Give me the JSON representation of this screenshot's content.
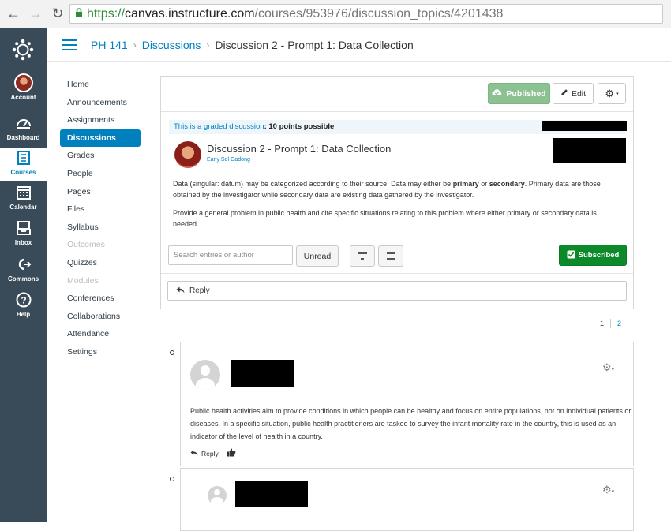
{
  "browser": {
    "url_scheme": "https://",
    "url_host": "canvas.instructure.com",
    "url_path": "/courses/953976/discussion_topics/4201438"
  },
  "global_nav": {
    "items": [
      {
        "label": "Account",
        "icon": "avatar"
      },
      {
        "label": "Dashboard",
        "icon": "dashboard-icon"
      },
      {
        "label": "Courses",
        "icon": "courses-icon",
        "active": true
      },
      {
        "label": "Calendar",
        "icon": "calendar-icon"
      },
      {
        "label": "Inbox",
        "icon": "inbox-icon"
      },
      {
        "label": "Commons",
        "icon": "commons-icon"
      },
      {
        "label": "Help",
        "icon": "help-icon"
      }
    ]
  },
  "breadcrumb": {
    "course": "PH 141",
    "section": "Discussions",
    "current": "Discussion 2 - Prompt 1: Data Collection"
  },
  "course_nav": {
    "items": [
      {
        "label": "Home"
      },
      {
        "label": "Announcements"
      },
      {
        "label": "Assignments"
      },
      {
        "label": "Discussions",
        "active": true
      },
      {
        "label": "Grades"
      },
      {
        "label": "People"
      },
      {
        "label": "Pages"
      },
      {
        "label": "Files"
      },
      {
        "label": "Syllabus"
      },
      {
        "label": "Outcomes",
        "disabled": true
      },
      {
        "label": "Quizzes"
      },
      {
        "label": "Modules",
        "disabled": true
      },
      {
        "label": "Conferences"
      },
      {
        "label": "Collaborations"
      },
      {
        "label": "Attendance"
      },
      {
        "label": "Settings"
      }
    ]
  },
  "topic": {
    "published_label": "Published",
    "edit_label": "Edit",
    "graded_prefix": "This is a graded discussion",
    "graded_points": ": 10 points possible",
    "title": "Discussion 2 - Prompt 1: Data Collection",
    "author": "Early Sol Gadong",
    "para1_a": "Data (singular: datum) may be categorized according to their source. Data may either be ",
    "para1_b": "primary",
    "para1_c": " or ",
    "para1_d": "secondary",
    "para1_e": ". Primary data are those obtained by the investigator while secondary data are existing data gathered by the investigator.",
    "para2": "Provide a general problem in public health and cite specific situations relating to this problem where either primary or secondary data is needed.",
    "search_placeholder": "Search entries or author",
    "unread_label": "Unread",
    "subscribed_label": "Subscribed",
    "reply_label": "Reply"
  },
  "pagination": {
    "page1": "1",
    "page2": "2"
  },
  "entries": [
    {
      "text": "Public health activities aim to provide conditions in which people can be healthy and focus on entire populations, not on individual patients or diseases. In a specific situation, public health practitioners are tasked to survey the infant mortality rate in the country, this is used as an indicator of the level of health in a country.",
      "reply_label": "Reply"
    }
  ],
  "colors": {
    "global_nav_bg": "#394b58",
    "link_blue": "#0081bd",
    "published_green": "#8cc191",
    "subscribed_green": "#0c8a2a"
  }
}
